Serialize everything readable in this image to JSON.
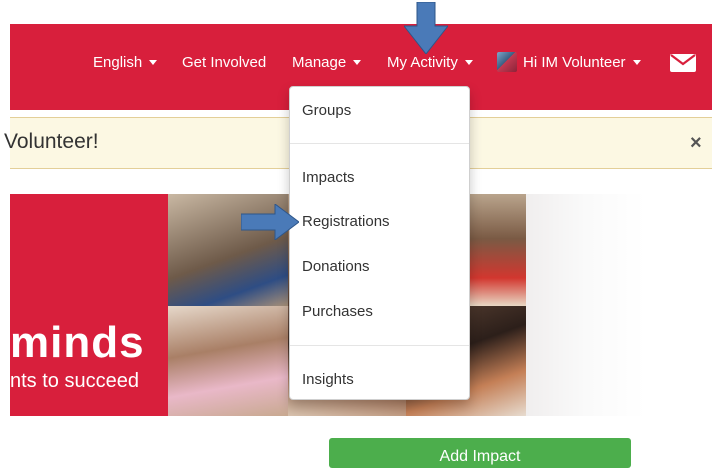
{
  "navbar": {
    "language": "English",
    "get_involved": "Get Involved",
    "manage": "Manage",
    "my_activity": "My Activity",
    "user_greeting": "Hi IM Volunteer",
    "mail_icon": "envelope-icon",
    "color": "#d81f3c"
  },
  "alert": {
    "message": "Volunteer!",
    "close": "×"
  },
  "hero": {
    "headline": "minds",
    "tagline": "nts to succeed"
  },
  "dropdown": {
    "items": [
      "Groups",
      "Impacts",
      "Registrations",
      "Donations",
      "Purchases",
      "Insights"
    ]
  },
  "actions": {
    "add_impact": "Add Impact"
  },
  "annotations": {
    "arrow_color": "#4a7ab8"
  }
}
